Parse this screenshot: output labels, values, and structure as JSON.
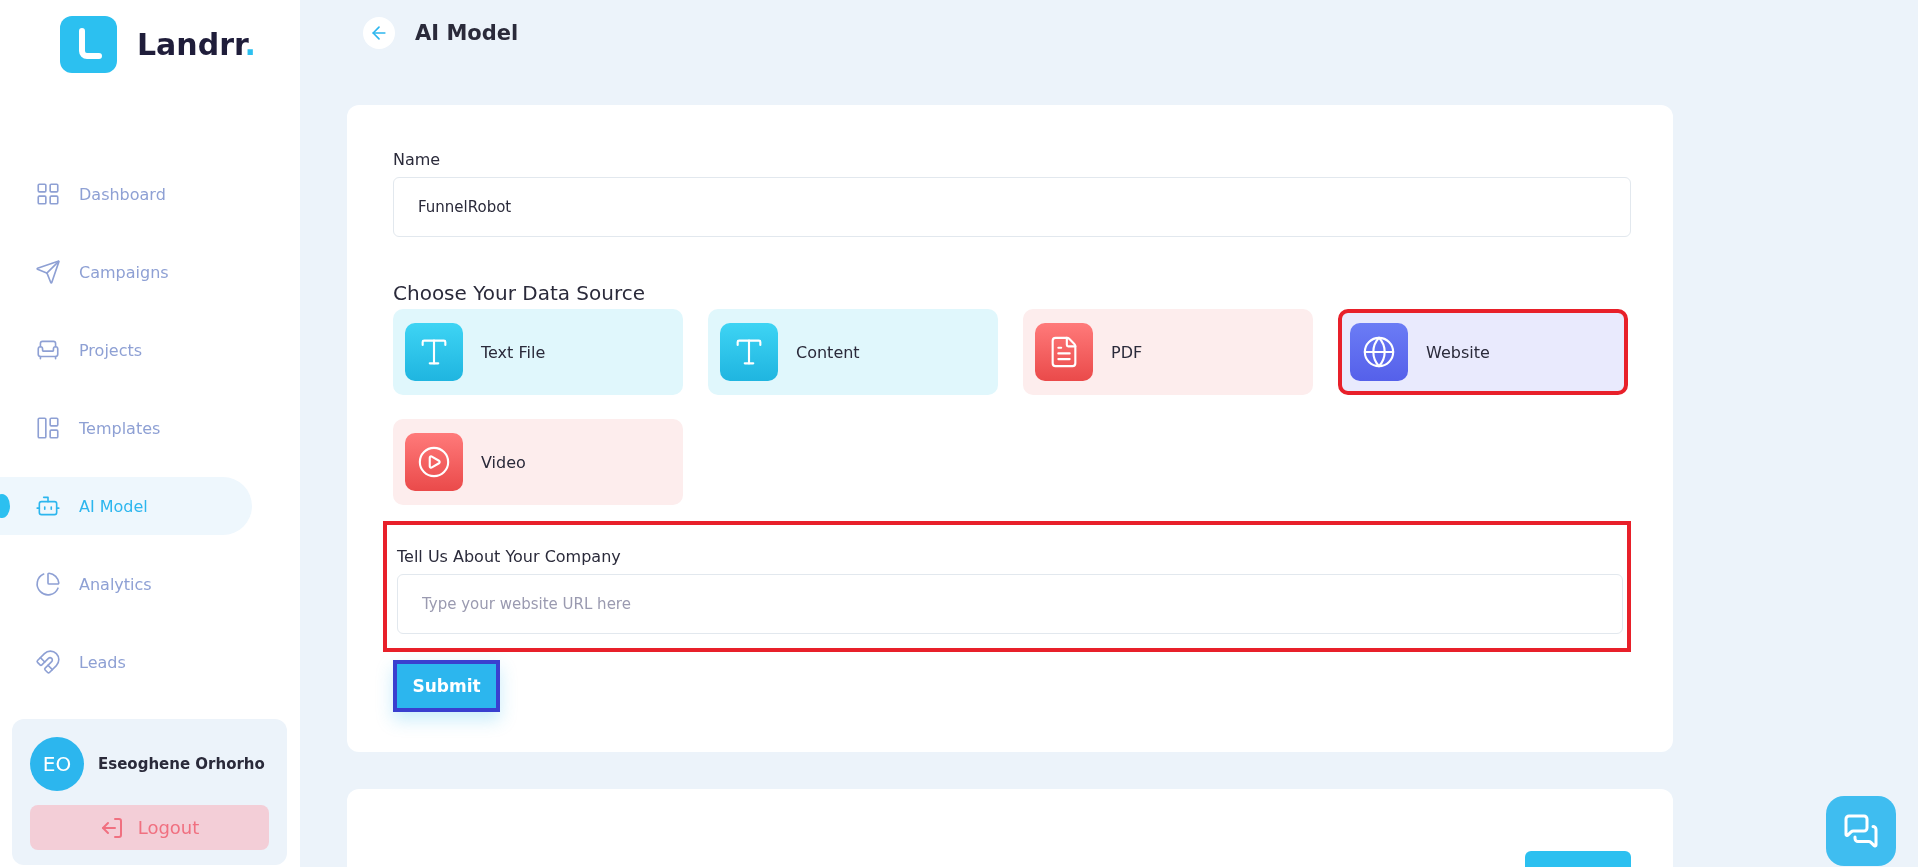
{
  "brand": {
    "name": "Landrr",
    "dot": "."
  },
  "sidebar": {
    "items": [
      {
        "label": "Dashboard",
        "kind": "dashboard",
        "selected": false
      },
      {
        "label": "Campaigns",
        "kind": "campaigns",
        "selected": false
      },
      {
        "label": "Projects",
        "kind": "projects",
        "selected": false
      },
      {
        "label": "Templates",
        "kind": "templates",
        "selected": false
      },
      {
        "label": "AI Model",
        "kind": "ai",
        "selected": true
      },
      {
        "label": "Analytics",
        "kind": "analytics",
        "selected": false
      },
      {
        "label": "Leads",
        "kind": "leads",
        "selected": false
      }
    ]
  },
  "user": {
    "initials": "EO",
    "name": "Eseoghene Orhorho",
    "logout": "Logout"
  },
  "page": {
    "title": "AI Model"
  },
  "form": {
    "name_label": "Name",
    "name_value": "FunnelRobot",
    "source_heading": "Choose Your Data Source",
    "sources": [
      {
        "label": "Text File",
        "kind": "text",
        "selected": false
      },
      {
        "label": "Content",
        "kind": "text",
        "selected": false
      },
      {
        "label": "PDF",
        "kind": "pdf",
        "selected": false
      },
      {
        "label": "Website",
        "kind": "web",
        "selected": true
      },
      {
        "label": "Video",
        "kind": "video",
        "selected": false
      }
    ],
    "company": {
      "label": "Tell Us About Your Company",
      "placeholder": "Type your website URL here",
      "highlighted": true
    },
    "submit": "Submit"
  }
}
